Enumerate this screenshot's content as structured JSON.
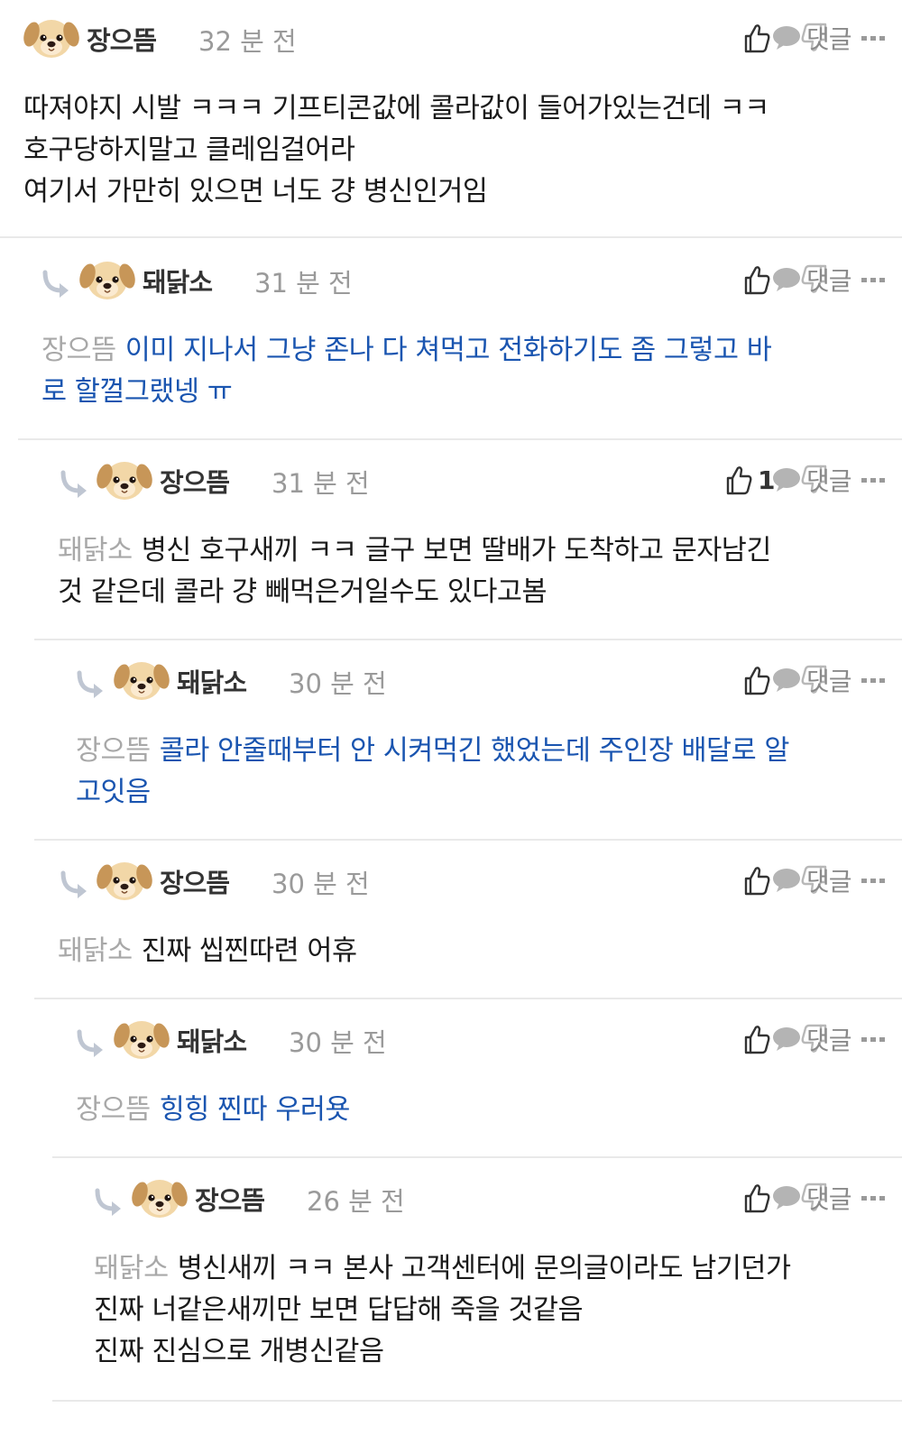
{
  "labels": {
    "reply": "댓글"
  },
  "comments": [
    {
      "user": "장으뜸",
      "time": "32 분 전",
      "likes": "",
      "mention": "",
      "lines": [
        "따져야지 시발 ㅋㅋㅋ 기프티콘값에 콜라값이 들어가있는건데 ㅋㅋ",
        "호구당하지말고 클레임걸어라",
        "여기서 가만히 있으면 너도 걍 병신인거임"
      ],
      "highlight": false
    },
    {
      "user": "돼닭소",
      "time": "31 분 전",
      "likes": "",
      "mention": "장으뜸",
      "lines": [
        "이미 지나서 그냥 존나 다 쳐먹고 전화하기도 좀 그렇고 바",
        "로 할껄그랬넹 ㅠ"
      ],
      "highlight": true
    },
    {
      "user": "장으뜸",
      "time": "31 분 전",
      "likes": "1",
      "mention": "돼닭소",
      "lines": [
        "병신 호구새끼 ㅋㅋ 글구 보면 딸배가 도착하고 문자남긴",
        "것 같은데 콜라 걍 빼먹은거일수도 있다고봄"
      ],
      "highlight": false
    },
    {
      "user": "돼닭소",
      "time": "30 분 전",
      "likes": "",
      "mention": "장으뜸",
      "lines": [
        "콜라 안줄때부터 안 시켜먹긴 했었는데 주인장 배달로 알",
        "고잇음"
      ],
      "highlight": true
    },
    {
      "user": "장으뜸",
      "time": "30 분 전",
      "likes": "",
      "mention": "돼닭소",
      "lines": [
        "진짜 씹찐따련 어휴"
      ],
      "highlight": false
    },
    {
      "user": "돼닭소",
      "time": "30 분 전",
      "likes": "",
      "mention": "장으뜸",
      "lines": [
        "힝힝 찐따 우러욧"
      ],
      "highlight": true
    },
    {
      "user": "장으뜸",
      "time": "26 분 전",
      "likes": "",
      "mention": "돼닭소",
      "lines": [
        "병신새끼 ㅋㅋ 본사 고객센터에 문의글이라도 남기던가",
        "진짜 너같은새끼만 보면 답답해 죽을 것같음",
        "진짜 진심으로 개병신같음"
      ],
      "highlight": false
    }
  ],
  "icons": {
    "like": "thumbs-up-icon",
    "dislike": "thumbs-down-icon",
    "more": "more-dots-icon",
    "reply": "speech-bubble-icon",
    "reply_indent": "reply-arrow-icon",
    "avatar": "puppy-avatar"
  },
  "colors": {
    "username": "#333333",
    "time": "#9a9a9a",
    "mention": "#a8a8a8",
    "highlight_text": "#1a55b0",
    "divider": "#e9e9e9"
  }
}
